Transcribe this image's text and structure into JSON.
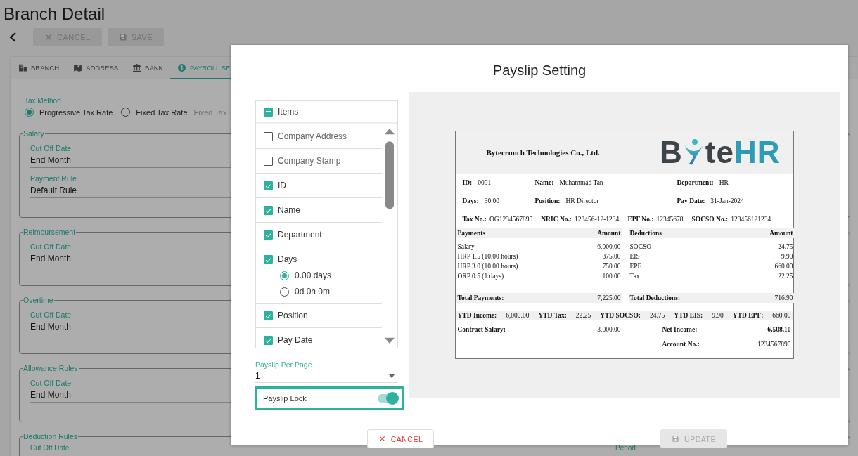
{
  "page": {
    "title": "Branch Detail",
    "actions": [
      {
        "label": "CANCEL",
        "disabled": true
      },
      {
        "label": "SAVE",
        "disabled": true
      }
    ]
  },
  "tabs": [
    {
      "label": "BRANCH",
      "selected": false
    },
    {
      "label": "ADDRESS",
      "selected": false
    },
    {
      "label": "BANK",
      "selected": false
    },
    {
      "label": "PAYROLL SE",
      "selected": true
    }
  ],
  "tax_method": {
    "label": "Tax Method",
    "options": [
      {
        "label": "Progressive Tax Rate",
        "selected": true
      },
      {
        "label": "Fixed Tax Rate",
        "selected": false
      }
    ],
    "extra_field": "Fixed Tax"
  },
  "sections": [
    {
      "title": "Salary",
      "fields": [
        {
          "label": "Cut Off Date",
          "value": "End Month"
        },
        {
          "label": "Payment Rule",
          "value": "Default Rule"
        }
      ]
    },
    {
      "title": "Reimbursement",
      "fields": [
        {
          "label": "Cut Off Date",
          "value": "End Month"
        }
      ]
    },
    {
      "title": "Overtime",
      "fields": [
        {
          "label": "Cut Off Date",
          "value": "End Month"
        }
      ]
    },
    {
      "title": "Allowance Rules",
      "fields": [
        {
          "label": "Cut Off Date",
          "value": "End Month"
        }
      ]
    },
    {
      "title": "Deduction Rules",
      "fields": [
        {
          "label": "Cut Off Date"
        }
      ],
      "side_fields": [
        {
          "label": "Period"
        }
      ]
    }
  ],
  "modal": {
    "title": "Payslip Setting",
    "items_header": {
      "label": "Items",
      "indeterminate": true
    },
    "items": [
      {
        "label": "Company Address",
        "checked": false
      },
      {
        "label": "Company Stamp",
        "checked": false
      },
      {
        "label": "ID",
        "checked": true
      },
      {
        "label": "Name",
        "checked": true
      },
      {
        "label": "Department",
        "checked": true
      },
      {
        "label": "Days",
        "checked": true,
        "options": [
          {
            "label": "0.00 days",
            "selected": true
          },
          {
            "label": "0d 0h 0m",
            "selected": false
          }
        ]
      },
      {
        "label": "Position",
        "checked": true
      },
      {
        "label": "Pay Date",
        "checked": true
      }
    ],
    "per_page": {
      "label": "Payslip Per Page",
      "value": "1"
    },
    "lock": {
      "label": "Payslip Lock",
      "on": true
    },
    "buttons": [
      {
        "label": "CANCEL",
        "disabled": false
      },
      {
        "label": "UPDATE",
        "disabled": true
      }
    ],
    "payslip": {
      "company": "Bytecrunch Technologies Co., Ltd.",
      "logo": {
        "lead": "B",
        "tail": "te",
        "accent": "HR"
      },
      "info_rows": [
        [
          {
            "label": "ID:",
            "value": "0001"
          },
          {
            "label": "Name:",
            "value": "Muhammad Tan"
          },
          {
            "label": "Department:",
            "value": "HR"
          }
        ],
        [
          {
            "label": "Days:",
            "value": "30.00"
          },
          {
            "label": "Position:",
            "value": "HR Director"
          },
          {
            "label": "Pay Date:",
            "value": "31-Jan-2024"
          }
        ]
      ],
      "ids": [
        {
          "label": "Tax No.:",
          "value": "OG1234567890"
        },
        {
          "label": "NRIC No.:",
          "value": "123456-12-1234"
        },
        {
          "label": "EPF No.:",
          "value": "12345678"
        },
        {
          "label": "SOCSO No.:",
          "value": "123456121234"
        }
      ],
      "payments": {
        "title": "Payments",
        "amount_title": "Amount",
        "rows": [
          {
            "name": "Salary",
            "amount": "6,000.00"
          },
          {
            "name": "HRP 1.5 (10.00 hours)",
            "amount": "375.00"
          },
          {
            "name": "HRP 3.0 (10.00 hours)",
            "amount": "750.00"
          },
          {
            "name": "ORP 0.5 (1 days)",
            "amount": "100.00"
          }
        ],
        "total_label": "Total Payments:",
        "total": "7,225.00"
      },
      "deductions": {
        "title": "Deductions",
        "amount_title": "Amount",
        "rows": [
          {
            "name": "SOCSO",
            "amount": "24.75"
          },
          {
            "name": "EIS",
            "amount": "9.90"
          },
          {
            "name": "EPF",
            "amount": "660.00"
          },
          {
            "name": "Tax",
            "amount": "22.25"
          }
        ],
        "total_label": "Total Deductions:",
        "total": "716.90"
      },
      "ytd": [
        {
          "label": "YTD Income:",
          "value": "6,000.00"
        },
        {
          "label": "YTD Tax:",
          "value": "22.25"
        },
        {
          "label": "YTD SOCSO:",
          "value": "24.75"
        },
        {
          "label": "YTD EIS:",
          "value": "9.90"
        },
        {
          "label": "YTD EPF:",
          "value": "660.00"
        }
      ],
      "contract": {
        "label": "Contract Salary:",
        "value": "3,000.00"
      },
      "net": [
        {
          "label": "Net Income:",
          "value": "6,508.10",
          "strong": true
        },
        {
          "label": "Account No.:",
          "value": "1234567890",
          "strong": false
        }
      ]
    }
  }
}
